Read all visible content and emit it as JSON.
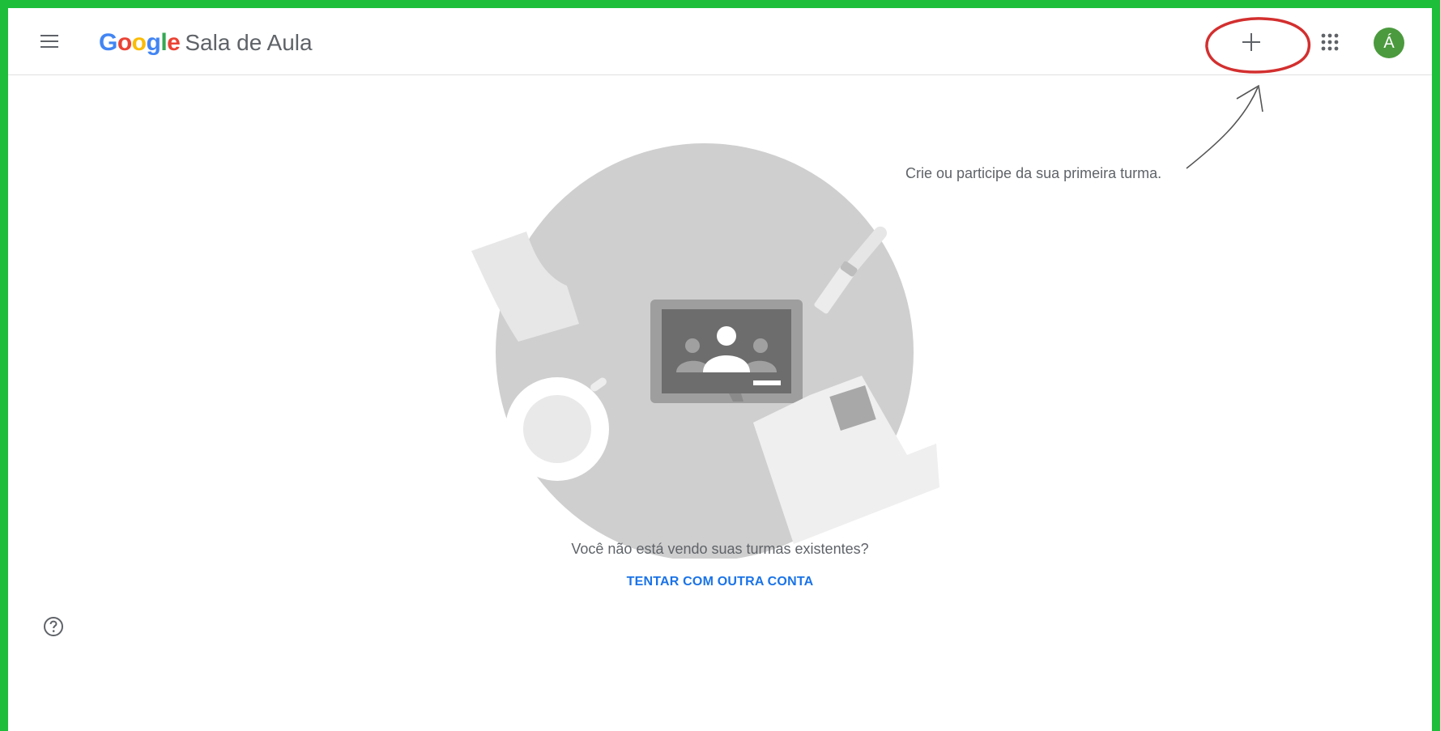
{
  "header": {
    "logo_letters": [
      {
        "char": "G",
        "color": "#4285F4"
      },
      {
        "char": "o",
        "color": "#EA4335"
      },
      {
        "char": "o",
        "color": "#FBBC05"
      },
      {
        "char": "g",
        "color": "#4285F4"
      },
      {
        "char": "l",
        "color": "#34A853"
      },
      {
        "char": "e",
        "color": "#EA4335"
      }
    ],
    "product_name": "Sala de Aula",
    "menu_icon": "hamburger-icon",
    "create_icon": "plus-icon",
    "apps_icon": "apps-grid-icon",
    "avatar_letter": "Á",
    "avatar_color": "#4b9a3e"
  },
  "annotation": {
    "hint_text": "Crie ou participe da sua primeira turma.",
    "circle_color": "#d32f2f"
  },
  "empty_state": {
    "question": "Você não está vendo suas turmas existentes?",
    "retry_label": "TENTAR COM OUTRA CONTA"
  },
  "footer": {
    "help_icon": "help-circle-icon"
  },
  "colors": {
    "frame_border": "#1dbf3a",
    "link": "#1a73e8",
    "text_secondary": "#5f6368"
  }
}
